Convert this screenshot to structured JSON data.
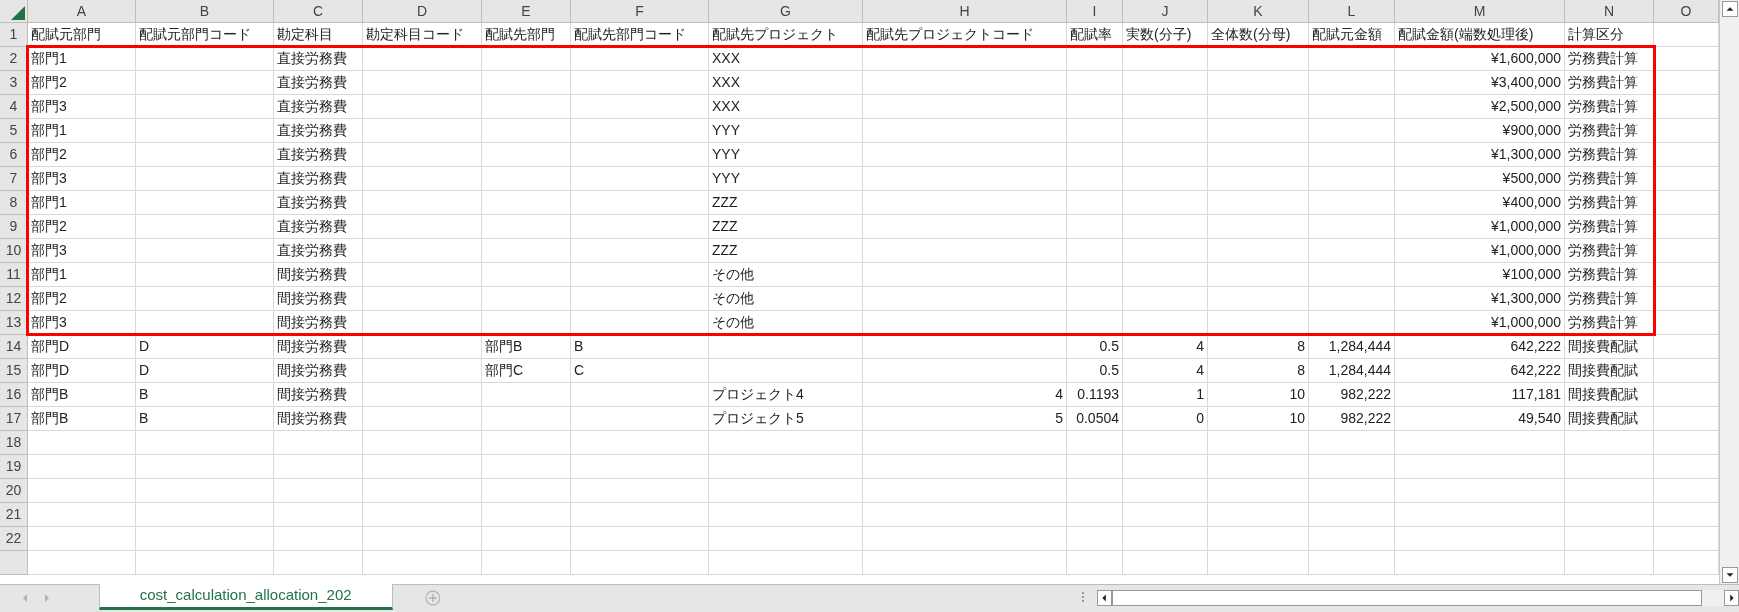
{
  "column_letters": [
    "A",
    "B",
    "C",
    "D",
    "E",
    "F",
    "G",
    "H",
    "I",
    "J",
    "K",
    "L",
    "M",
    "N",
    "O"
  ],
  "header_row": {
    "number": "1",
    "A": "配賦元部門",
    "B": "配賦元部門コード",
    "C": "勘定科目",
    "D": "勘定科目コード",
    "E": "配賦先部門",
    "F": "配賦先部門コード",
    "G": "配賦先プロジェクト",
    "H": "配賦先プロジェクトコード",
    "I": "配賦率",
    "J": "実数(分子)",
    "K": "全体数(分母)",
    "L": "配賦元金額",
    "M": "配賦金額(端数処理後)",
    "N": "計算区分"
  },
  "outlined_rows": [
    {
      "number": "2",
      "A": "部門1",
      "C": "直接労務費",
      "G": "XXX",
      "M": "¥1,600,000",
      "N": "労務費計算"
    },
    {
      "number": "3",
      "A": "部門2",
      "C": "直接労務費",
      "G": "XXX",
      "M": "¥3,400,000",
      "N": "労務費計算"
    },
    {
      "number": "4",
      "A": "部門3",
      "C": "直接労務費",
      "G": "XXX",
      "M": "¥2,500,000",
      "N": "労務費計算"
    },
    {
      "number": "5",
      "A": "部門1",
      "C": "直接労務費",
      "G": "YYY",
      "M": "¥900,000",
      "N": "労務費計算"
    },
    {
      "number": "6",
      "A": "部門2",
      "C": "直接労務費",
      "G": "YYY",
      "M": "¥1,300,000",
      "N": "労務費計算"
    },
    {
      "number": "7",
      "A": "部門3",
      "C": "直接労務費",
      "G": "YYY",
      "M": "¥500,000",
      "N": "労務費計算"
    },
    {
      "number": "8",
      "A": "部門1",
      "C": "直接労務費",
      "G": "ZZZ",
      "M": "¥400,000",
      "N": "労務費計算"
    },
    {
      "number": "9",
      "A": "部門2",
      "C": "直接労務費",
      "G": "ZZZ",
      "M": "¥1,000,000",
      "N": "労務費計算"
    },
    {
      "number": "10",
      "A": "部門3",
      "C": "直接労務費",
      "G": "ZZZ",
      "M": "¥1,000,000",
      "N": "労務費計算"
    },
    {
      "number": "11",
      "A": "部門1",
      "C": "間接労務費",
      "G": "その他",
      "M": "¥100,000",
      "N": "労務費計算"
    },
    {
      "number": "12",
      "A": "部門2",
      "C": "間接労務費",
      "G": "その他",
      "M": "¥1,300,000",
      "N": "労務費計算"
    },
    {
      "number": "13",
      "A": "部門3",
      "C": "間接労務費",
      "G": "その他",
      "M": "¥1,000,000",
      "N": "労務費計算"
    }
  ],
  "other_rows": [
    {
      "number": "14",
      "A": "部門D",
      "B": "D",
      "C": "間接労務費",
      "E": "部門B",
      "F": "B",
      "I": "0.5",
      "J": "4",
      "K": "8",
      "L": "1,284,444",
      "M": "642,222",
      "N": "間接費配賦"
    },
    {
      "number": "15",
      "A": "部門D",
      "B": "D",
      "C": "間接労務費",
      "E": "部門C",
      "F": "C",
      "I": "0.5",
      "J": "4",
      "K": "8",
      "L": "1,284,444",
      "M": "642,222",
      "N": "間接費配賦"
    },
    {
      "number": "16",
      "A": "部門B",
      "B": "B",
      "C": "間接労務費",
      "G": "プロジェクト4",
      "H": "4",
      "I": "0.1193",
      "J": "1",
      "K": "10",
      "L": "982,222",
      "M": "117,181",
      "N": "間接費配賦"
    },
    {
      "number": "17",
      "A": "部門B",
      "B": "B",
      "C": "間接労務費",
      "G": "プロジェクト5",
      "H": "5",
      "I": "0.0504",
      "J": "0",
      "K": "10",
      "L": "982,222",
      "M": "49,540",
      "N": "間接費配賦"
    },
    {
      "number": "18"
    },
    {
      "number": "19"
    },
    {
      "number": "20"
    },
    {
      "number": "21"
    },
    {
      "number": "22"
    }
  ],
  "sheet_tabs": [
    {
      "label": "cost_calculation_allocation_202",
      "selected": true
    }
  ]
}
